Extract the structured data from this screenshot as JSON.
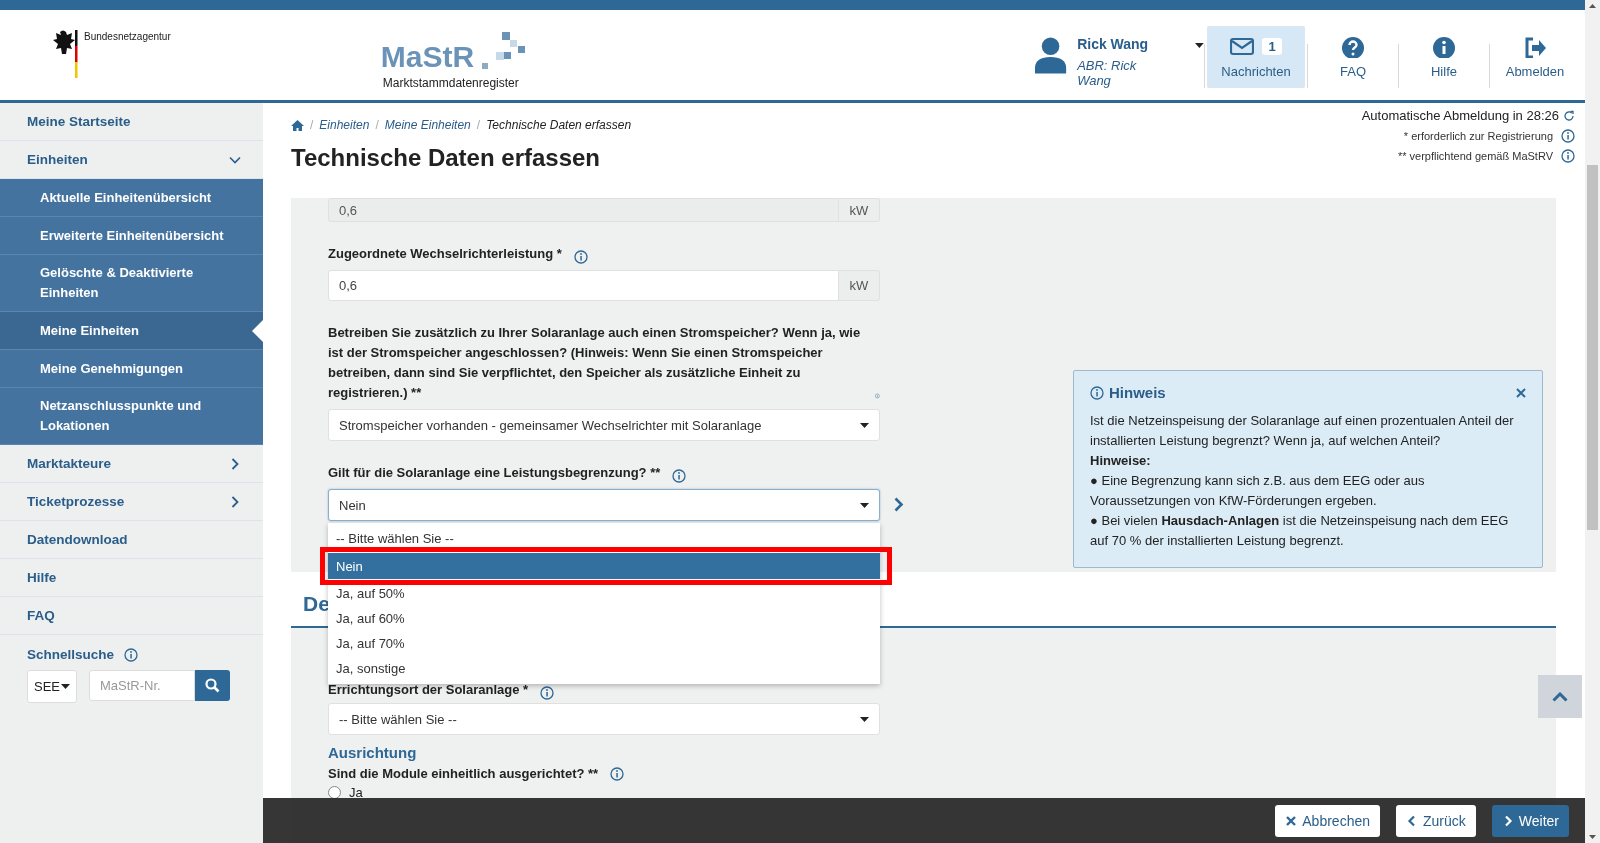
{
  "header": {
    "agency": "Bundesnetzagentur",
    "logo": {
      "title": "MaStR",
      "subtitle": "Marktstammdatenregister"
    },
    "user": {
      "name": "Rick Wang",
      "role": "ABR: Rick Wang"
    },
    "nav": [
      {
        "kind": "messages",
        "label": "Nachrichten",
        "badge": "1",
        "selected": true
      },
      {
        "kind": "faq",
        "label": "FAQ",
        "selected": false
      },
      {
        "kind": "help",
        "label": "Hilfe",
        "selected": false
      },
      {
        "kind": "logout",
        "label": "Abmelden",
        "selected": false
      }
    ]
  },
  "sidebar": {
    "items": [
      {
        "kind": "link",
        "label": "Meine Startseite",
        "selected": false
      },
      {
        "kind": "group",
        "label": "Einheiten",
        "expanded": true,
        "selected": false,
        "children": [
          {
            "label": "Aktuelle Einheitenübersicht",
            "selected": false
          },
          {
            "label": "Erweiterte Einheitenübersicht",
            "selected": false
          },
          {
            "label": "Gelöschte & Deaktivierte Einheiten",
            "selected": false
          },
          {
            "label": "Meine Einheiten",
            "selected": true
          },
          {
            "label": "Meine Genehmigungen",
            "selected": false
          },
          {
            "label": "Netzanschlusspunkte und Lokationen",
            "selected": false
          }
        ]
      },
      {
        "kind": "group",
        "label": "Marktakteure",
        "expanded": false,
        "selected": false
      },
      {
        "kind": "group",
        "label": "Ticketprozesse",
        "expanded": false,
        "selected": false
      },
      {
        "kind": "link",
        "label": "Datendownload",
        "selected": false
      },
      {
        "kind": "link",
        "label": "Hilfe",
        "selected": false
      },
      {
        "kind": "link",
        "label": "FAQ",
        "selected": false
      }
    ],
    "quick_search": {
      "label": "Schnellsuche",
      "type": "SEE",
      "placeholder": "MaStR-Nr."
    }
  },
  "main": {
    "session": "Automatische Abmeldung in 28:26",
    "breadcrumb_separator": "/",
    "breadcrumb": [
      "Einheiten",
      "Meine Einheiten",
      "Technische Daten erfassen"
    ],
    "title": "Technische Daten erfassen",
    "legend": [
      "* erforderlich zur Registrierung",
      "** verpflichtend gemäß MaStRV"
    ],
    "form": {
      "fields": [
        {
          "kind": "unit_input",
          "value": "0,6",
          "unit": "kW",
          "disabled": true
        },
        {
          "kind": "unit_input",
          "label": "Zugeordnete Wechselrichterleistung *",
          "value": "0,6",
          "unit": "kW",
          "disabled": false
        },
        {
          "kind": "select",
          "label": "Betreiben Sie zusätzlich zu Ihrer Solaranlage auch einen Stromspeicher? Wenn ja, wie ist der Stromspeicher angeschlossen? (Hinweis: Wenn Sie einen Stromspeicher betreiben, dann sind Sie verpflichtet, den Speicher als zusätzliche Einheit zu registrieren.) **",
          "value": "Stromspeicher vorhanden - gemeinsamer Wechselrichter mit Solaranlage",
          "open": false
        },
        {
          "kind": "select",
          "label": "Gilt für die Solaranlage eine Leistungsbegrenzung? **",
          "value": "Nein",
          "open": true,
          "options": [
            {
              "label": "-- Bitte wählen Sie --",
              "selected": false,
              "annotated": false
            },
            {
              "label": "Nein",
              "selected": true,
              "annotated": true
            },
            {
              "label": "Ja, auf 50%",
              "selected": false,
              "annotated": false
            },
            {
              "label": "Ja, auf 60%",
              "selected": false,
              "annotated": false
            },
            {
              "label": "Ja, auf 70%",
              "selected": false,
              "annotated": false
            },
            {
              "label": "Ja, sonstige",
              "selected": false,
              "annotated": false
            }
          ]
        }
      ],
      "hint": {
        "title": "Hinweis",
        "text": "Ist die Netzeinspeisung der Solaranlage auf einen prozentualen Anteil der installierten Leistung begrenzt? Wenn ja, auf welchen Anteil?",
        "heading": "Hinweise:",
        "bullets": [
          "● Eine Begrenzung kann sich z.B. aus dem EEG oder aus Voraussetzungen von KfW-Förderungen ergeben.",
          "● Bei vielen **Hausdach-Anlagen** ist die Netzeinspeisung nach dem EEG auf 70 % der installierten Leistung begrenzt."
        ]
      }
    },
    "section": {
      "title": "De",
      "fields": [
        {
          "kind": "select",
          "label": "Errichtungsort der Solaranlage *",
          "value": "-- Bitte wählen Sie --",
          "open": false
        }
      ],
      "subsection": "Ausrichtung",
      "question": "Sind die Module einheitlich ausgerichtet? **",
      "options": [
        {
          "label": "Ja",
          "selected": false
        }
      ]
    }
  },
  "footer": {
    "buttons": [
      {
        "kind": "cancel",
        "label": "Abbrechen"
      },
      {
        "kind": "back",
        "label": "Zurück"
      },
      {
        "kind": "next",
        "label": "Weiter"
      }
    ]
  }
}
